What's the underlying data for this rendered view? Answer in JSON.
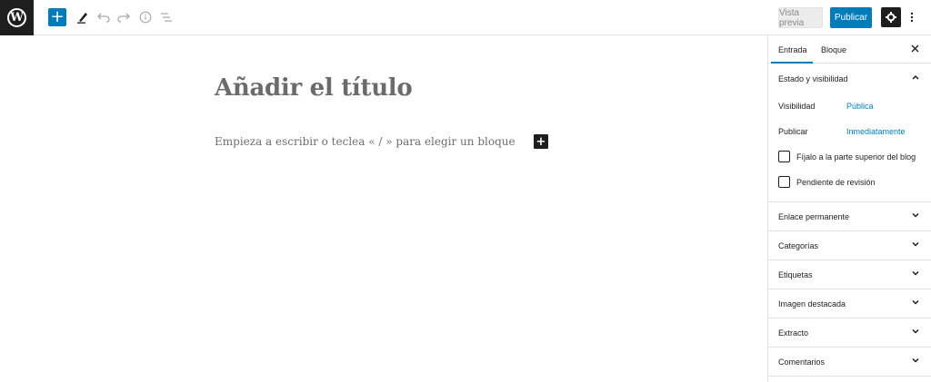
{
  "colors": {
    "accent": "#007cba",
    "dark": "#1e1e1e",
    "border": "#e0e0e0"
  },
  "toolbar": {
    "logo_icon": "wordpress-icon",
    "add_icon": "+",
    "tools_icon": "pencil-icon",
    "undo_icon": "undo-icon",
    "redo_icon": "redo-icon",
    "info_icon": "info-icon",
    "outline_icon": "list-view-icon",
    "preview_label": "Vista previa",
    "publish_label": "Publicar",
    "settings_icon": "gear-icon",
    "more_icon": "more-vertical-icon"
  },
  "editor": {
    "title_placeholder": "Añadir el título",
    "body_placeholder": "Empieza a escribir o teclea « / » para elegir un bloque",
    "inline_add": "+"
  },
  "sidebar": {
    "tabs": [
      {
        "label": "Entrada",
        "active": true
      },
      {
        "label": "Bloque",
        "active": false
      }
    ],
    "close_icon": "close-icon",
    "status_panel": {
      "title": "Estado y visibilidad",
      "visibility_label": "Visibilidad",
      "visibility_value": "Pública",
      "publish_label": "Publicar",
      "publish_value": "Inmediatamente",
      "sticky_label": "Fíjalo a la parte superior del blog",
      "sticky_checked": false,
      "pending_label": "Pendiente de revisión",
      "pending_checked": false
    },
    "panels": [
      "Enlace permanente",
      "Categorías",
      "Etiquetas",
      "Imagen destacada",
      "Extracto",
      "Comentarios"
    ]
  }
}
